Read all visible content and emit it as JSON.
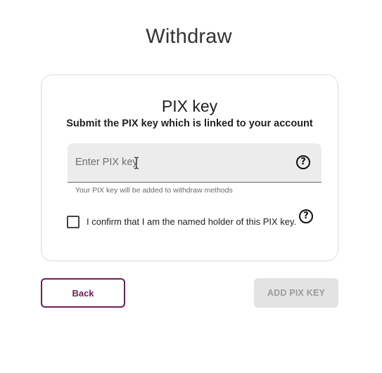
{
  "page": {
    "title": "Withdraw"
  },
  "card": {
    "title": "PIX key",
    "subtitle": "Submit the PIX key which is linked to your account",
    "pix_input": {
      "placeholder": "Enter PIX key",
      "value": "",
      "help_icon": "question-circle-icon"
    },
    "helper_text": "Your PIX key will be added to withdraw methods",
    "confirm": {
      "checked": false,
      "label": "I confirm that I am the named holder of this PIX key.",
      "help_icon": "question-circle-icon"
    }
  },
  "actions": {
    "back_label": "Back",
    "add_label": "ADD PIX KEY",
    "add_disabled": true
  },
  "colors": {
    "brand": "#6d1e57",
    "disabled_bg": "#e3e3e3",
    "disabled_text": "#9a9a9a",
    "input_bg": "#ececec"
  }
}
